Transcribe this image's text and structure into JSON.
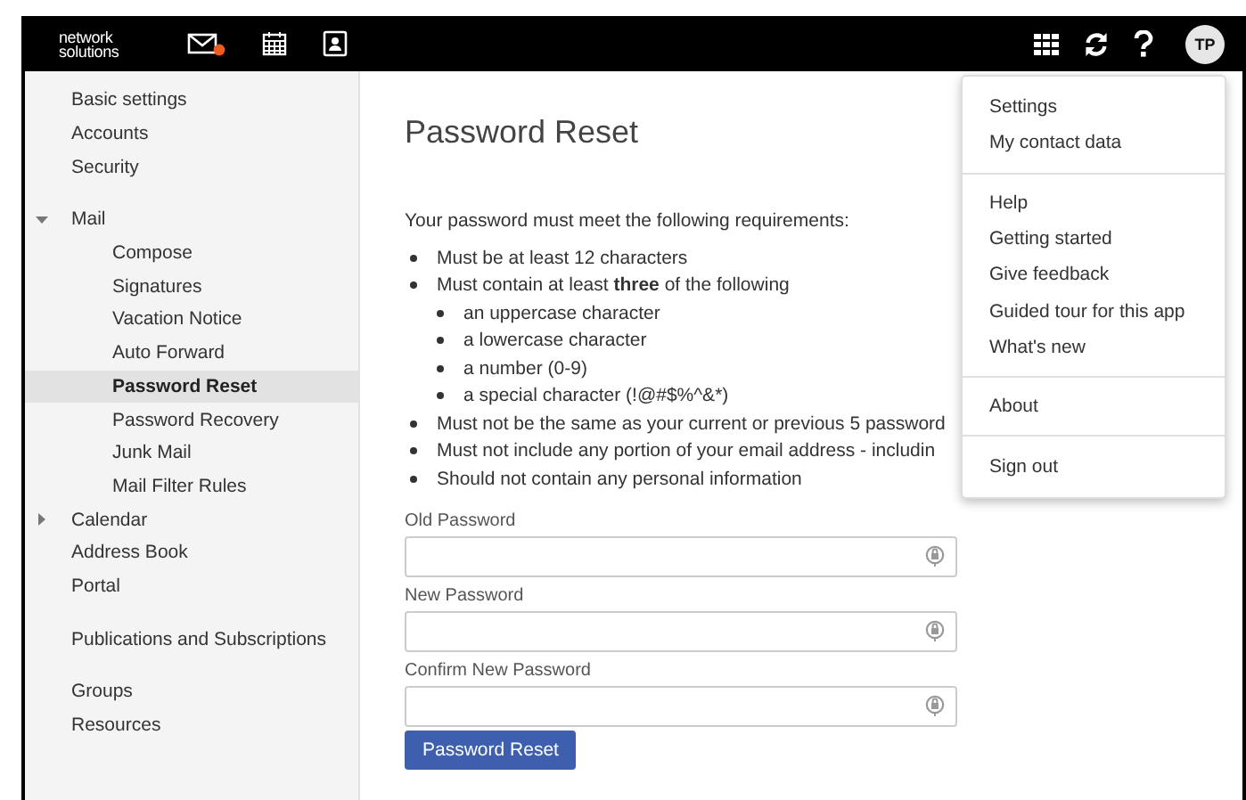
{
  "header": {
    "logo": [
      "network",
      "solutions"
    ],
    "mail": {
      "unread": true
    },
    "avatar": "TP"
  },
  "sidebar": {
    "groups": [
      {
        "items": [
          {
            "label": "Basic settings",
            "selected": false
          },
          {
            "label": "Accounts",
            "selected": false
          },
          {
            "label": "Security",
            "selected": false
          }
        ]
      },
      {
        "items": [
          {
            "label": "Mail",
            "selected": false,
            "expanded": true,
            "children": [
              {
                "label": "Compose",
                "selected": false
              },
              {
                "label": "Signatures",
                "selected": false
              },
              {
                "label": "Vacation Notice",
                "selected": false
              },
              {
                "label": "Auto Forward",
                "selected": false
              },
              {
                "label": "Password Reset",
                "selected": true
              },
              {
                "label": "Password Recovery",
                "selected": false
              },
              {
                "label": "Junk Mail",
                "selected": false
              },
              {
                "label": "Mail Filter Rules",
                "selected": false
              }
            ]
          },
          {
            "label": "Calendar",
            "selected": false,
            "expanded": false
          },
          {
            "label": "Address Book",
            "selected": false
          },
          {
            "label": "Portal",
            "selected": false
          }
        ]
      },
      {
        "items": [
          {
            "label": "Publications and Subscriptions",
            "selected": false
          }
        ]
      },
      {
        "items": [
          {
            "label": "Groups",
            "selected": false
          },
          {
            "label": "Resources",
            "selected": false
          }
        ]
      }
    ]
  },
  "page": {
    "title": "Password Reset",
    "intro": "Your password must meet the following requirements:",
    "requirements": [
      {
        "text": "Must be at least 12 characters"
      },
      {
        "text": "Must contain at least **three** of the following",
        "children": [
          {
            "text": "an uppercase character"
          },
          {
            "text": "a lowercase character"
          },
          {
            "text": "a number (0-9)"
          },
          {
            "text": "a special character (!@#$%^&*)"
          }
        ]
      },
      {
        "text": "Must not be the same as your current or previous 5 password"
      },
      {
        "text": "Must not include any portion of your email address - includin"
      },
      {
        "text": "Should not contain any personal information"
      }
    ],
    "fields": [
      {
        "label": "Old Password"
      },
      {
        "label": "New Password"
      },
      {
        "label": "Confirm New Password"
      }
    ],
    "button": "Password Reset"
  },
  "menu": {
    "sections": [
      [
        "Settings",
        "My contact data"
      ],
      [
        "Help",
        "Getting started",
        "Give feedback",
        "Guided tour for this app",
        "What's new"
      ],
      [
        "About"
      ],
      [
        "Sign out"
      ]
    ]
  }
}
